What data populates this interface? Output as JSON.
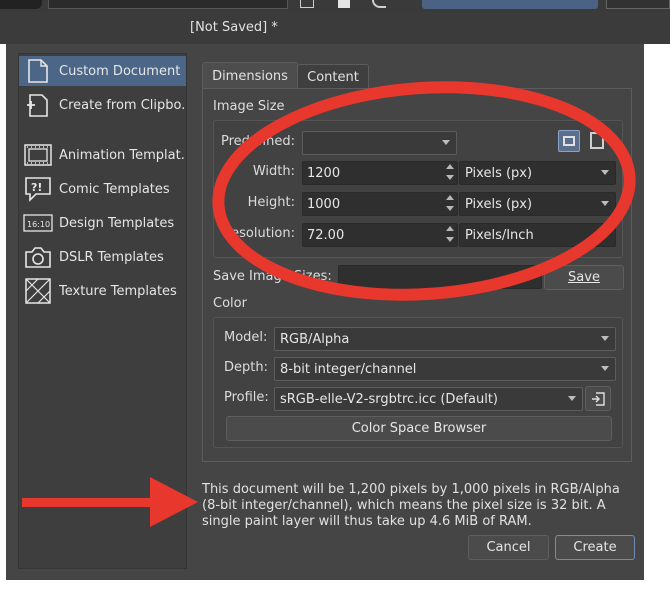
{
  "window": {
    "title": "[Not Saved]  *"
  },
  "sidebar": {
    "items": [
      {
        "label": "Custom Document",
        "icon": "document-icon",
        "selected": true
      },
      {
        "label": "Create from Clipbo...",
        "icon": "clipboard-new-icon"
      },
      {
        "label": "Animation Templat...",
        "icon": "film-icon"
      },
      {
        "label": "Comic Templates",
        "icon": "speech-bubble-icon"
      },
      {
        "label": "Design Templates",
        "icon": "ratio-icon",
        "badge": "16:10"
      },
      {
        "label": "DSLR Templates",
        "icon": "camera-icon"
      },
      {
        "label": "Texture Templates",
        "icon": "texture-icon"
      }
    ]
  },
  "tabs": [
    {
      "label": "Dimensions",
      "active": true
    },
    {
      "label": "Content",
      "active": false
    }
  ],
  "image_size": {
    "section_label": "Image Size",
    "predefined_label": "Predefined:",
    "predefined_value": "",
    "width_label": "Width:",
    "width_value": "1200",
    "width_unit": "Pixels (px)",
    "height_label": "Height:",
    "height_value": "1000",
    "height_unit": "Pixels (px)",
    "resolution_label": "Resolution:",
    "resolution_value": "72.00",
    "resolution_unit": "Pixels/Inch",
    "save_sizes_label": "Save Image Sizes:",
    "save_sizes_value": "",
    "save_button": "Save"
  },
  "color": {
    "section_label": "Color",
    "model_label": "Model:",
    "model_value": "RGB/Alpha",
    "depth_label": "Depth:",
    "depth_value": "8-bit integer/channel",
    "profile_label": "Profile:",
    "profile_value": "sRGB-elle-V2-srgbtrc.icc (Default)",
    "color_space_button": "Color Space Browser"
  },
  "description": "This document will be 1,200 pixels by 1,000 pixels in RGB/Alpha (8-bit integer/channel), which means the pixel size is 32 bit. A single paint layer will thus take up 4.6 MiB of RAM.",
  "footer": {
    "cancel": "Cancel",
    "create": "Create"
  },
  "colors": {
    "accent": "#4b6687",
    "annotation": "#e8372c"
  }
}
